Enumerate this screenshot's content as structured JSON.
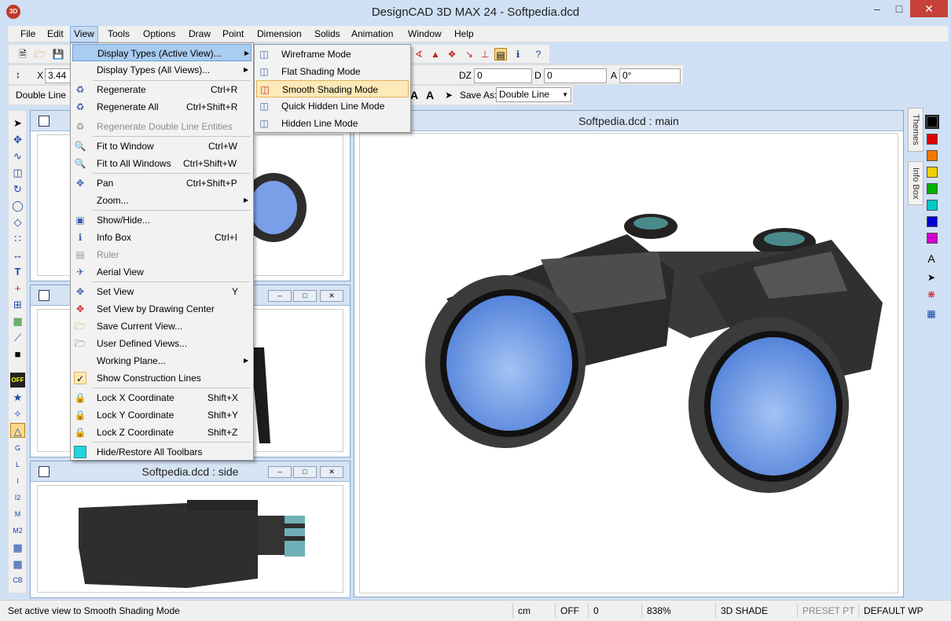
{
  "titlebar": {
    "title": "DesignCAD 3D MAX 24 - Softpedia.dcd",
    "app_icon": "3D"
  },
  "menubar": [
    "File",
    "Edit",
    "View",
    "Tools",
    "Options",
    "Draw",
    "Point",
    "Dimension",
    "Solids",
    "Animation",
    "Window",
    "Help"
  ],
  "coords": {
    "x_label": "X",
    "x_value": "3.44",
    "dz_label": "DZ",
    "dz_value": "0",
    "d_label": "D",
    "d_value": "0",
    "a_label": "A",
    "a_value": "0°"
  },
  "linestyle": {
    "left_value": "Double Line",
    "save_as_label": "Save As:",
    "save_as_value": "Double Line"
  },
  "view_menu": {
    "items": [
      {
        "label": "Display Types (Active View)...",
        "shortcut": "",
        "submenu": true,
        "icon": ""
      },
      {
        "label": "Display Types (All Views)...",
        "shortcut": "",
        "submenu": true,
        "icon": ""
      },
      {
        "label": "Regenerate",
        "shortcut": "Ctrl+R",
        "icon": "regenerate-icon"
      },
      {
        "label": "Regenerate All",
        "shortcut": "Ctrl+Shift+R",
        "icon": "regenerate-all-icon"
      },
      {
        "label": "Regenerate Double Line Entities",
        "shortcut": "",
        "icon": "regenerate-double-icon"
      },
      {
        "label": "Fit to Window",
        "shortcut": "Ctrl+W",
        "icon": "fit-window-icon"
      },
      {
        "label": "Fit to All Windows",
        "shortcut": "Ctrl+Shift+W",
        "icon": "fit-all-icon"
      },
      {
        "label": "Pan",
        "shortcut": "Ctrl+Shift+P",
        "icon": "pan-icon"
      },
      {
        "label": "Zoom...",
        "shortcut": "",
        "submenu": true,
        "icon": ""
      },
      {
        "label": "Show/Hide...",
        "shortcut": "",
        "icon": "show-hide-icon"
      },
      {
        "label": "Info Box",
        "shortcut": "Ctrl+I",
        "icon": "info-icon"
      },
      {
        "label": "Ruler",
        "shortcut": "",
        "icon": "ruler-icon"
      },
      {
        "label": "Aerial View",
        "shortcut": "",
        "icon": "aerial-view-icon"
      },
      {
        "label": "Set View",
        "shortcut": "Y",
        "icon": "set-view-icon"
      },
      {
        "label": "Set View by Drawing Center",
        "shortcut": "",
        "icon": "set-view-center-icon"
      },
      {
        "label": "Save Current View...",
        "shortcut": "",
        "icon": "save-view-icon"
      },
      {
        "label": "User Defined Views...",
        "shortcut": "",
        "icon": "user-views-icon"
      },
      {
        "label": "Working Plane...",
        "shortcut": "",
        "submenu": true,
        "icon": ""
      },
      {
        "label": "Show Construction Lines",
        "shortcut": "",
        "icon": "check-icon"
      },
      {
        "label": "Lock X Coordinate",
        "shortcut": "Shift+X",
        "icon": "lock-x-icon"
      },
      {
        "label": "Lock Y Coordinate",
        "shortcut": "Shift+Y",
        "icon": "lock-y-icon"
      },
      {
        "label": "Lock Z Coordinate",
        "shortcut": "Shift+Z",
        "icon": "lock-z-icon"
      },
      {
        "label": "Hide/Restore All Toolbars",
        "shortcut": "",
        "icon": "toolbars-icon"
      }
    ]
  },
  "display_submenu": [
    "Wireframe Mode",
    "Flat Shading Mode",
    "Smooth Shading Mode",
    "Quick Hidden Line Mode",
    "Hidden Line Mode"
  ],
  "views": {
    "main_title": "Softpedia.dcd : main",
    "side_title": "Softpedia.dcd : side"
  },
  "right_tabs": [
    "Themes",
    "Info Box"
  ],
  "colors": [
    "#000000",
    "#e00000",
    "#f07800",
    "#f0d000",
    "#00b000",
    "#00c8c8",
    "#0000d0",
    "#d000d0"
  ],
  "status": {
    "message": "Set active view to Smooth Shading Mode",
    "unit": "cm",
    "ortho": "OFF",
    "layer": "0",
    "zoom": "838%",
    "mode": "3D SHADE",
    "preset": "PRESET PT",
    "wp": "DEFAULT WP"
  }
}
